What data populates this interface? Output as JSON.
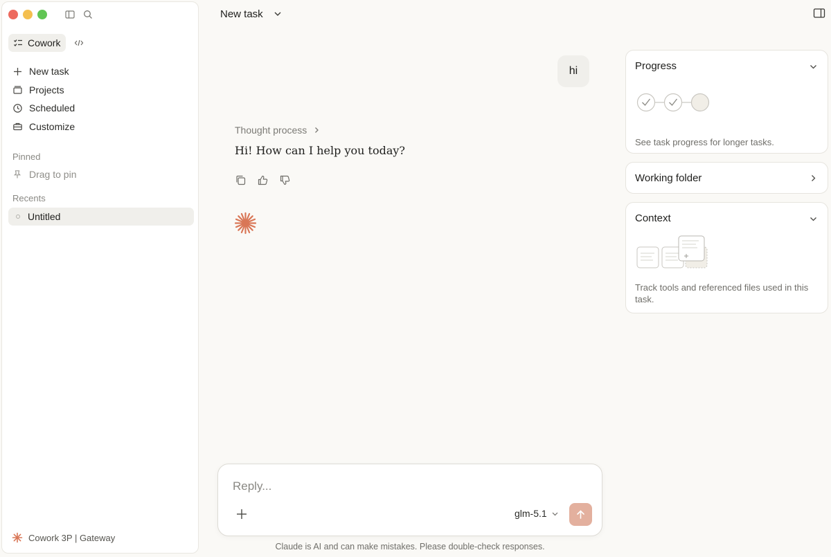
{
  "sidebar": {
    "mode_label": "Cowork",
    "nav_items": [
      {
        "label": "New task",
        "icon": "plus-icon"
      },
      {
        "label": "Projects",
        "icon": "folder-icon"
      },
      {
        "label": "Scheduled",
        "icon": "clock-icon"
      },
      {
        "label": "Customize",
        "icon": "toolbox-icon"
      }
    ],
    "pinned_label": "Pinned",
    "drag_to_pin": "Drag to pin",
    "recents_label": "Recents",
    "recents": [
      {
        "label": "Untitled"
      }
    ],
    "footer_label": "Cowork 3P | Gateway"
  },
  "header": {
    "title": "New task"
  },
  "chat": {
    "user_message": "hi",
    "thought_label": "Thought process",
    "assistant_message": "Hi! How can I help you today?"
  },
  "composer": {
    "placeholder": "Reply...",
    "model": "glm-5.1",
    "disclaimer": "Claude is AI and can make mistakes. Please double-check responses."
  },
  "right_panel": {
    "progress": {
      "title": "Progress",
      "description": "See task progress for longer tasks."
    },
    "working_folder": {
      "title": "Working folder"
    },
    "context": {
      "title": "Context",
      "description": "Track tools and referenced files used in this task."
    }
  },
  "colors": {
    "accent": "#d97757",
    "send_button": "#e3b09e",
    "background": "#faf9f6",
    "sidebar_active": "#f0efeb"
  }
}
